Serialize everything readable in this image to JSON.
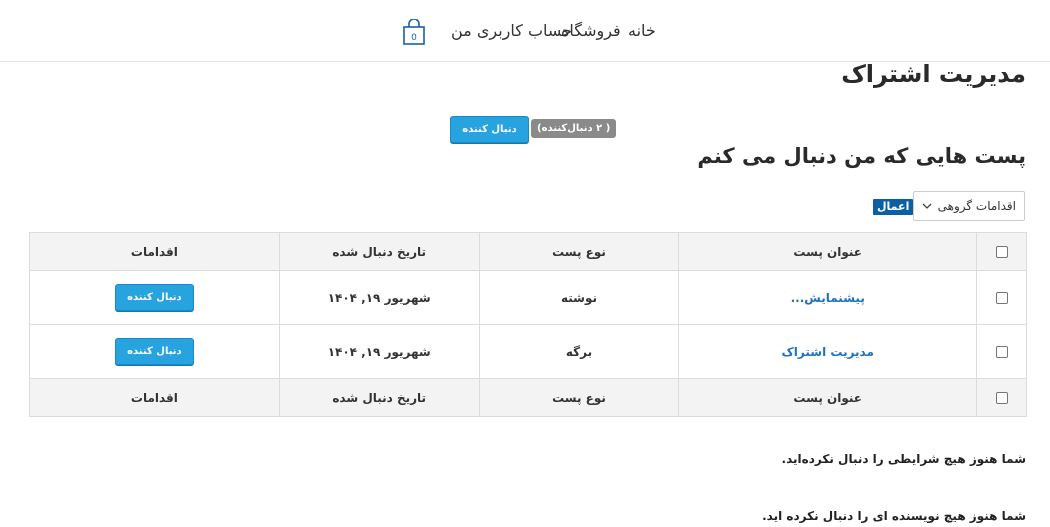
{
  "header": {
    "nav": [
      "خانه",
      "فروشگاه",
      "حساب کاربری من"
    ],
    "cart_icon": "shopping-bag-icon",
    "cart_count": "0"
  },
  "main": {
    "title": "مدیریت اشتراک",
    "follow_button": "دنبال کننده",
    "followers_badge": "( ۲ دنبال‌کننده)",
    "section_title": "پست هایی که من دنبال می کنم",
    "bulk_actions": {
      "selected": "اقدامات گروهی",
      "apply": "اعمال"
    },
    "table": {
      "columns": [
        "عنوان پست",
        "نوع پست",
        "تاریخ دنبال شده",
        "اقدامات"
      ],
      "rows": [
        {
          "title": "پیشنمایش...",
          "type": "نوشته",
          "date": "شهریور ۱۹, ۱۴۰۴",
          "action": "دنبال کننده"
        },
        {
          "title": "مدیریت اشتراک",
          "type": "برگه",
          "date": "شهریور ۱۹, ۱۴۰۴",
          "action": "دنبال کننده"
        }
      ]
    },
    "messages": {
      "conditions": "شما هنوز هیچ شرایطی را دنبال نکرده‌اید.",
      "authors": "شما هنوز هیچ نویسنده ای را دنبال نکرده اید."
    }
  },
  "colors": {
    "accent": "#27a3e0",
    "apply": "#0b5fa5",
    "link": "#1e73be",
    "badge": "#8a8a8a"
  }
}
